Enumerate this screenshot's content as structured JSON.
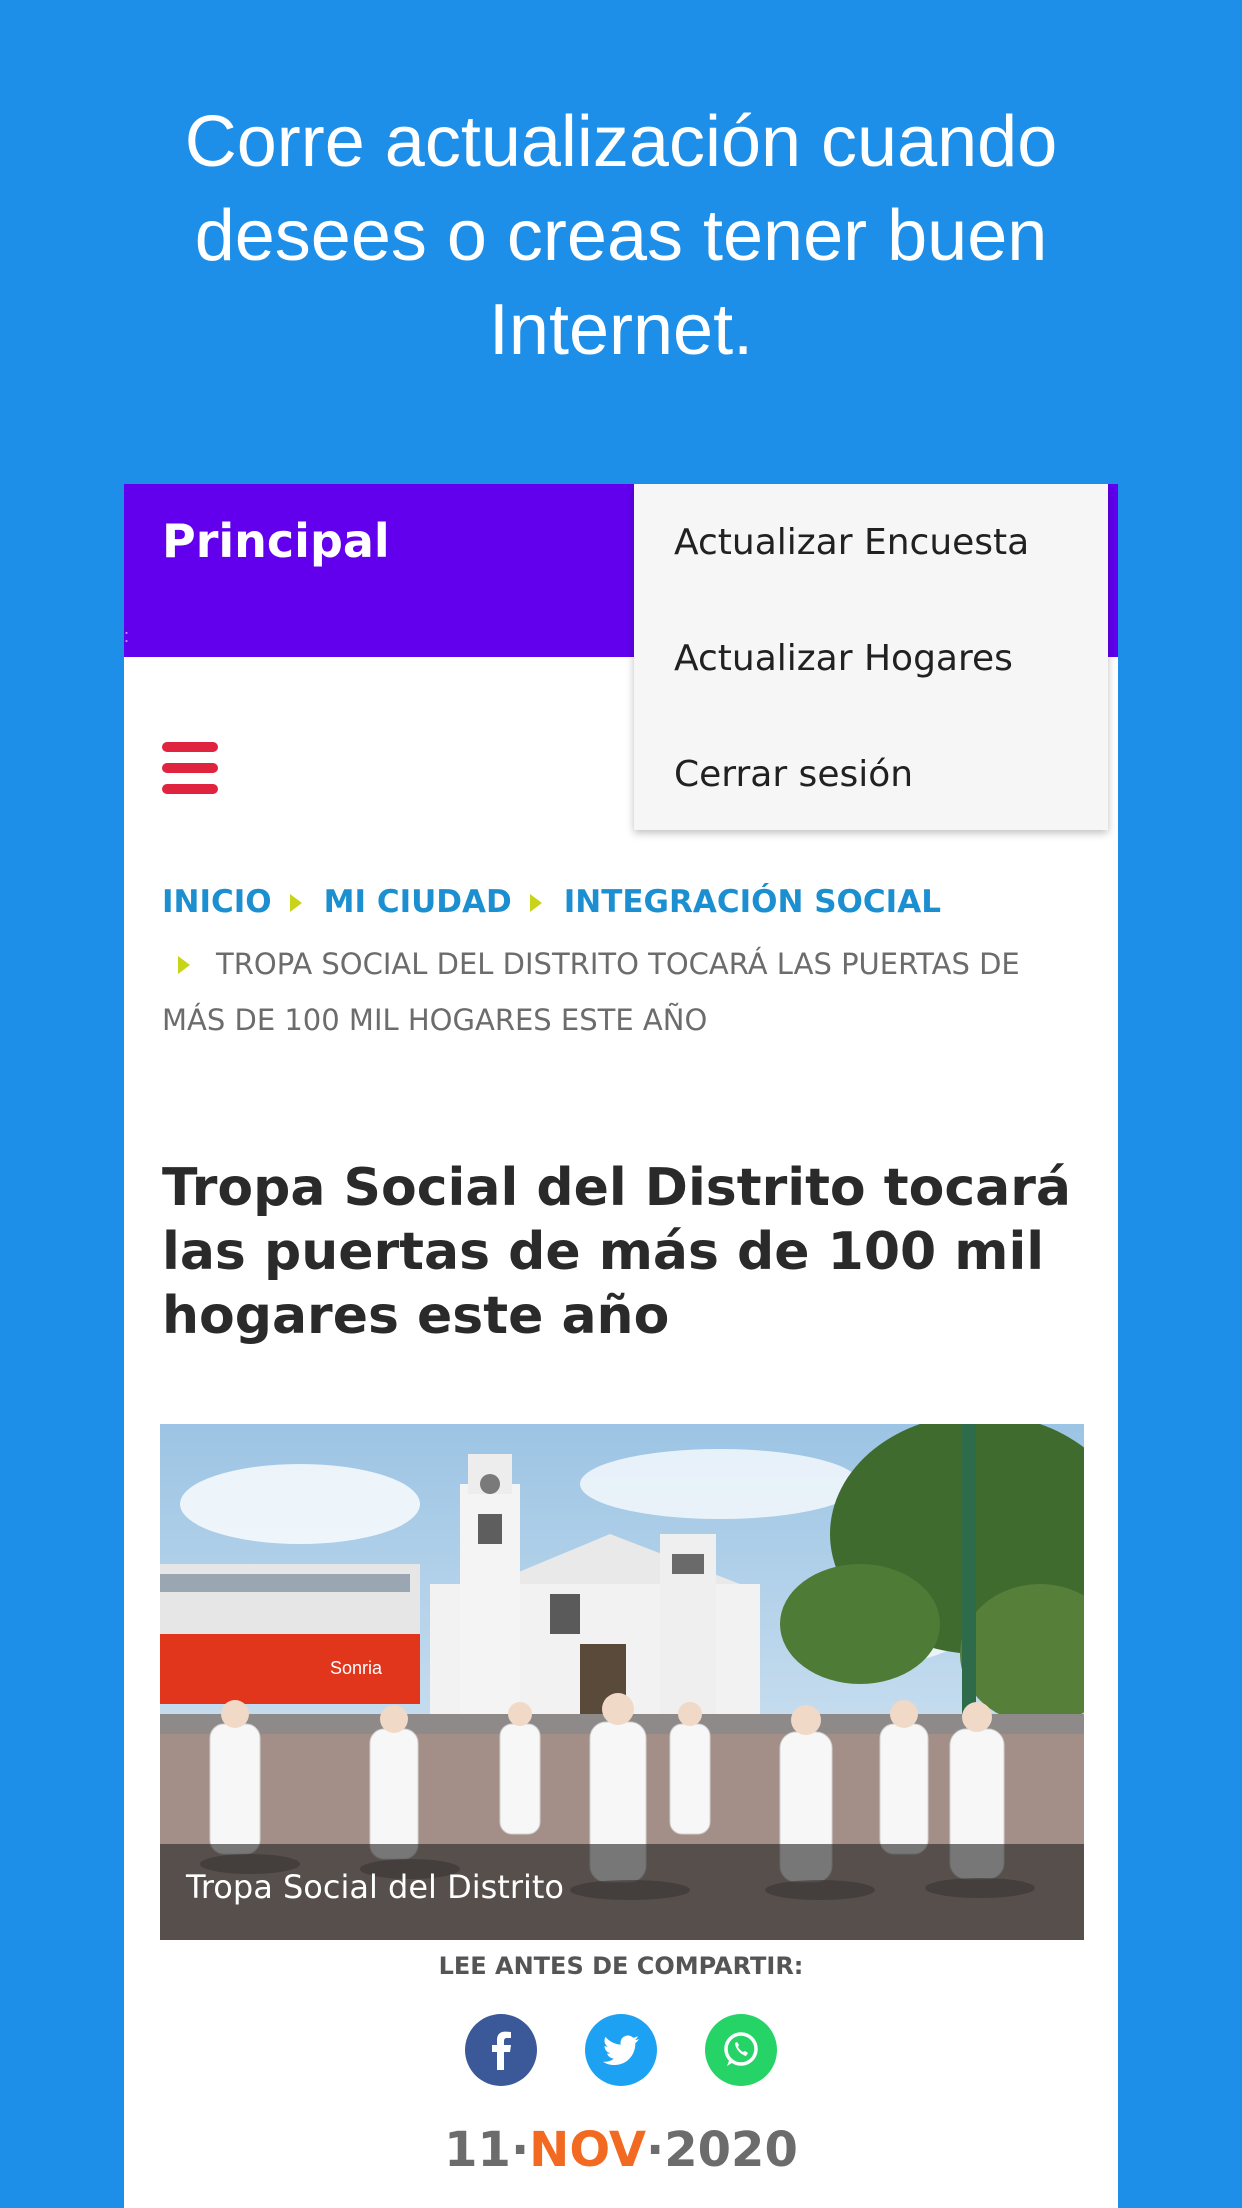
{
  "promo": {
    "text": "Corre actualización cuando desees o creas tener buen Internet."
  },
  "appbar": {
    "title": "Principal"
  },
  "menu": {
    "items": [
      {
        "label": "Actualizar Encuesta"
      },
      {
        "label": "Actualizar Hogares"
      },
      {
        "label": "Cerrar sesión"
      }
    ]
  },
  "breadcrumb": {
    "links": [
      "INICIO",
      "MI CIUDAD",
      "INTEGRACIÓN SOCIAL"
    ],
    "current": "TROPA SOCIAL DEL DISTRITO TOCARÁ LAS PUERTAS DE MÁS DE 100 MIL HOGARES ESTE AÑO"
  },
  "article": {
    "headline": "Tropa Social del Distrito tocará las puertas de más de 100 mil hogares este año",
    "image_caption": "Tropa Social del Distrito",
    "share_label": "LEE ANTES DE COMPARTIR:",
    "share_icons": [
      "facebook-icon",
      "twitter-icon",
      "whatsapp-icon"
    ],
    "date": {
      "day": "11",
      "month": "NOV",
      "year": "2020",
      "separator": "·"
    }
  },
  "colors": {
    "background": "#1E8FE8",
    "appbar": "#6200EE",
    "accent_red": "#E0243F",
    "link_blue": "#1C8FD0",
    "date_orange": "#F26A21",
    "facebook": "#3B5998",
    "twitter": "#1DA1F2",
    "whatsapp": "#25D366"
  }
}
